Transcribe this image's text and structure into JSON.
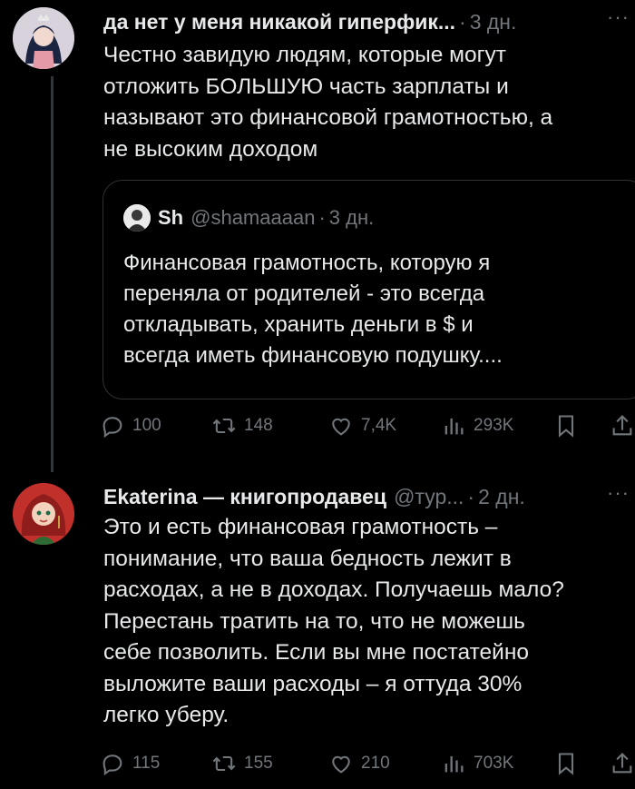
{
  "tweets": [
    {
      "name": "да нет у меня никакой гиперфик...",
      "handle": "",
      "time": "3 дн.",
      "text": "Честно завидую людям, которые могут\nотложить БОЛЬШУЮ часть зарплаты и\nназывают это финансовой грамотностью, а\nне высоким доходом",
      "quote": {
        "name": "Sh",
        "handle": "@shamaaaan",
        "time": "3 дн.",
        "text": "Финансовая грамотность, которую я\nпереняла от родителей - это всегда\nоткладывать, хранить деньги в $ и\nвсегда иметь финансовую подушку...."
      },
      "actions": {
        "replies": "100",
        "retweets": "148",
        "likes": "7,4K",
        "views": "293K"
      }
    },
    {
      "name": "Ekaterina — книгопродавец",
      "handle": "@тур...",
      "time": "2 дн.",
      "text": "Это и есть финансовая грамотность –\nпонимание, что ваша бедность лежит в\nрасходах, а не в доходах. Получаешь мало?\nПерестань тратить на то, что не можешь\nсебе позволить. Если вы мне постатейно\nвыложите ваши расходы – я оттуда 30%\nлегко уберу.",
      "actions": {
        "replies": "115",
        "retweets": "155",
        "likes": "210",
        "views": "703K"
      }
    }
  ],
  "separator": "·",
  "more_label": "···",
  "colors": {
    "background": "#000000",
    "text": "#e7e9ea",
    "muted": "#71767b",
    "border": "#2f3336"
  },
  "icons": [
    "reply-icon",
    "retweet-icon",
    "like-icon",
    "views-icon",
    "bookmark-icon",
    "share-icon"
  ]
}
